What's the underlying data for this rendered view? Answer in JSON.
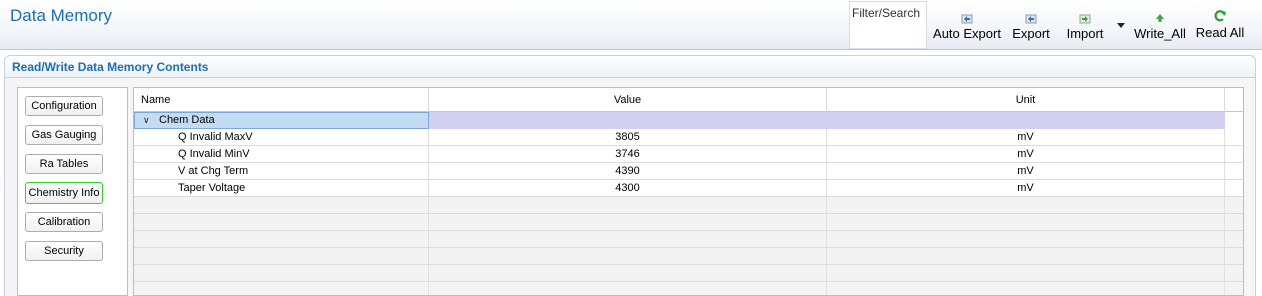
{
  "app": {
    "title": "Data Memory"
  },
  "toolbar": {
    "filter_label": "Filter/Search",
    "buttons": [
      {
        "label": "Auto Export",
        "icon": "export-icon"
      },
      {
        "label": "Export",
        "icon": "export-icon"
      },
      {
        "label": "Import",
        "icon": "import-icon"
      },
      {
        "label": "Write_All",
        "icon": "write-arrow-icon"
      },
      {
        "label": "Read All",
        "icon": "refresh-icon"
      }
    ]
  },
  "section": {
    "title": "Read/Write Data Memory Contents"
  },
  "sidebar": {
    "items": [
      {
        "label": "Configuration"
      },
      {
        "label": "Gas Gauging"
      },
      {
        "label": "Ra Tables"
      },
      {
        "label": "Chemistry Info"
      },
      {
        "label": "Calibration"
      },
      {
        "label": "Security"
      }
    ],
    "active_index": 3
  },
  "grid": {
    "columns": [
      "Name",
      "Value",
      "Unit"
    ],
    "group": {
      "label": "Chem Data",
      "expanded": true
    },
    "rows": [
      {
        "name": "Q Invalid MaxV",
        "value": "3805",
        "unit": "mV"
      },
      {
        "name": "Q Invalid MinV",
        "value": "3746",
        "unit": "mV"
      },
      {
        "name": "V at Chg Term",
        "value": "4390",
        "unit": "mV"
      },
      {
        "name": "Taper Voltage",
        "value": "4300",
        "unit": "mV"
      }
    ]
  },
  "colors": {
    "accent": "#1a6ec0",
    "group_row": "#c4dcf3",
    "group_row_value": "#d2cff0",
    "active_tab_border": "#2ed52e",
    "refresh_icon": "#2aa02a"
  }
}
